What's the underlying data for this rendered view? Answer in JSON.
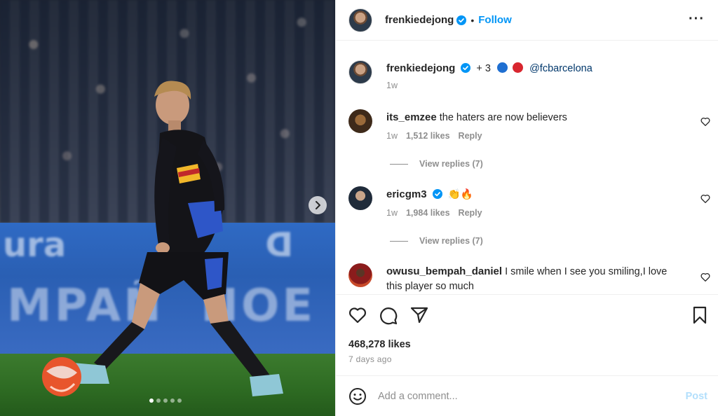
{
  "header": {
    "username": "frenkiedejong",
    "separator": "•",
    "follow_label": "Follow",
    "more_icon": "ellipsis-icon"
  },
  "caption": {
    "username": "frenkiedejong",
    "extra": "+ 3",
    "emoji_colors": [
      "#1f6fd1",
      "#d8262f"
    ],
    "mention": "@fcbarcelona",
    "time": "1w"
  },
  "comments": [
    {
      "username": "its_emzee",
      "text": "the haters are now believers",
      "time": "1w",
      "likes": "1,512 likes",
      "reply_label": "Reply",
      "view_replies": "View replies (7)"
    },
    {
      "username": "ericgm3",
      "text": "👏🔥",
      "time": "1w",
      "likes": "1,984 likes",
      "reply_label": "Reply",
      "view_replies": "View replies (7)"
    },
    {
      "username": "owusu_bempah_daniel",
      "text": "I smile when I see you smiling,I love this player so much"
    }
  ],
  "post": {
    "likes": "468,278 likes",
    "time_ago": "7 days ago"
  },
  "add_comment": {
    "placeholder": "Add a comment...",
    "post_label": "Post"
  },
  "carousel": {
    "total_slides": 5,
    "active_slide": 1
  },
  "colors": {
    "accent": "#0095f6",
    "verified": "#0095f6",
    "muted": "#8e8e8e",
    "post_disabled": "#b2dffc"
  }
}
